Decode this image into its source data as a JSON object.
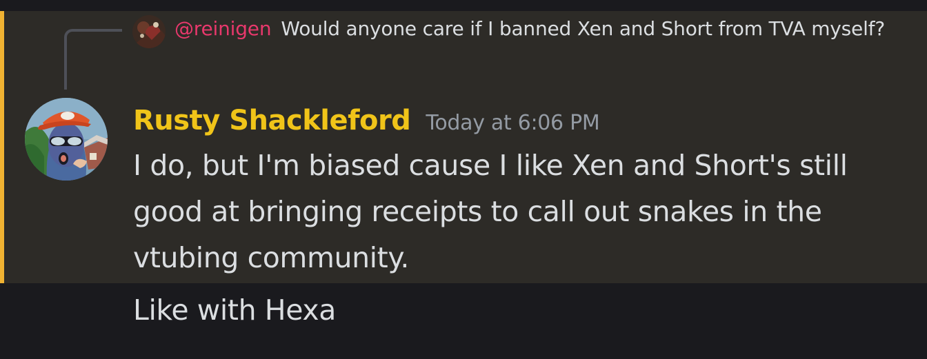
{
  "reply": {
    "author": "@reinigen",
    "text": "Would anyone care if I banned Xen and Short from TVA myself?"
  },
  "message": {
    "author": "Rusty Shackleford",
    "timestamp": "Today at 6:06 PM",
    "body": "I do, but I'm biased cause I like Xen and Short's still good at bringing receipts to call out snakes in the vtubing community."
  },
  "followup": {
    "body": "Like with Hexa"
  },
  "colors": {
    "mention_bar": "#f0b232",
    "highlight_bg": "#2d2b27",
    "reply_author": "#e8386c",
    "author_name": "#f0c419",
    "timestamp": "#949ba4",
    "text": "#dbdee1",
    "background": "#1a1a1e"
  },
  "icons": {
    "reply_avatar": "reply-author-avatar",
    "main_avatar": "author-avatar-balaclava-cap"
  }
}
